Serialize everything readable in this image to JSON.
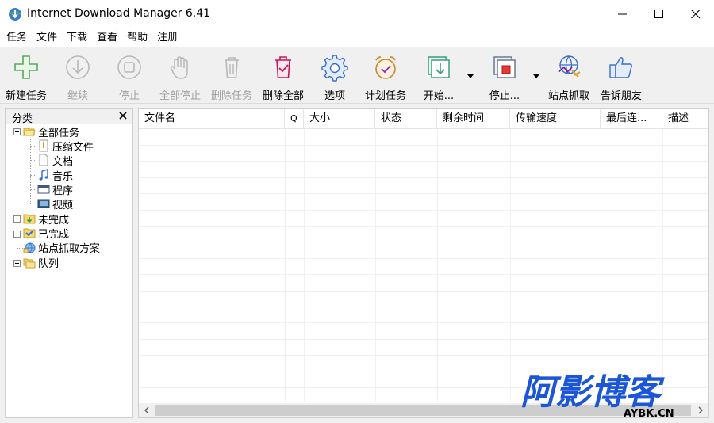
{
  "window": {
    "title": "Internet Download Manager 6.41"
  },
  "menu": [
    "任务",
    "文件",
    "下载",
    "查看",
    "帮助",
    "注册"
  ],
  "toolbar": {
    "new_task": "新建任务",
    "resume": "继续",
    "stop": "停止",
    "stop_all": "全部停止",
    "delete_task": "删除任务",
    "delete_all": "删除全部",
    "options": "选项",
    "scheduler": "计划任务",
    "start": "开始...",
    "stop_queue": "停止...",
    "grabber": "站点抓取",
    "tell_friend": "告诉朋友"
  },
  "categories": {
    "title": "分类",
    "items": [
      "全部任务",
      "压缩文件",
      "文档",
      "音乐",
      "程序",
      "视频",
      "未完成",
      "已完成",
      "站点抓取方案",
      "队列"
    ]
  },
  "columns": [
    "文件名",
    "Q",
    "大小",
    "状态",
    "剩余时间",
    "传输速度",
    "最后连...",
    "描述"
  ],
  "watermark": {
    "title": "阿影博客",
    "domain": "AYBK.CN"
  },
  "colors": {
    "accent_blue": "#2f6fd9",
    "watermark_blue": "#1a56d6",
    "icon_gray": "#8a8a8a",
    "disabled_gray": "#b8b8b8"
  }
}
